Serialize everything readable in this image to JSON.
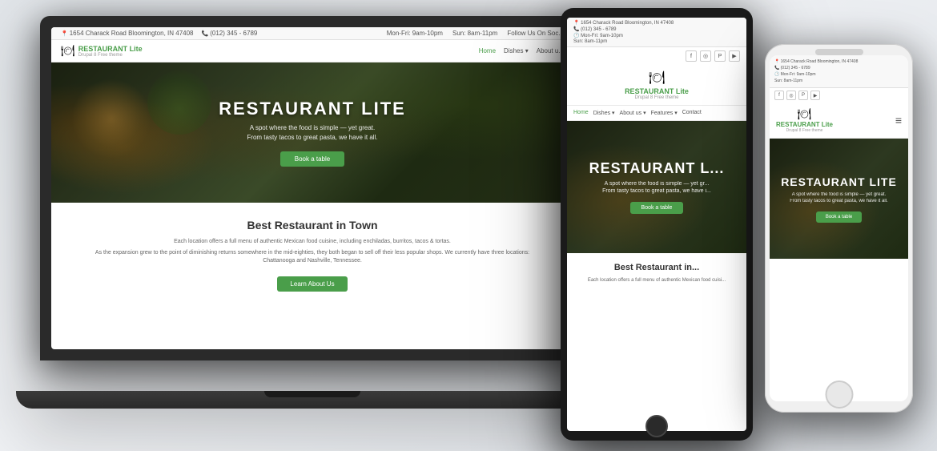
{
  "brand": {
    "name_prefix": "RESTAURANT",
    "name_suffix": "Lite",
    "drupal_label": "Drupal 8 Free theme",
    "icon": "🍽"
  },
  "topbar": {
    "address": "1654 Charack Road Bloomington, IN 47408",
    "phone": "(012) 345 - 6789",
    "hours_weekday": "Mon-Fri: 9am-10pm",
    "hours_weekend": "Sun: 8am-11pm",
    "follow_text": "Follow Us On Soc..."
  },
  "nav": {
    "items": [
      "Home",
      "Dishes ▾",
      "About us ▾",
      "Features ▾",
      "Contact"
    ],
    "active": "Home"
  },
  "hero": {
    "title": "RESTAURANT LITE",
    "subtitle1": "A spot where the food is simple — yet great.",
    "subtitle2": "From tasty tacos to great pasta, we have it all.",
    "cta": "Book a table"
  },
  "main": {
    "title": "Best Restaurant in Town",
    "text1": "Each location offers a full menu of authentic Mexican food cuisine, including enchiladas, burritos, tacos & tortas.",
    "text2": "As the expansion grew to the point of diminishing returns somewhere in the mid-eighties, they both began to sell off their less popular shops. We currently have three locations: Chattanooga and Nashville, Tennessee.",
    "cta": "Learn About Us"
  },
  "tablet_hero": {
    "title": "RESTAURANT L...",
    "subtitle1": "A spot where the food is simple — yet gr...",
    "subtitle2": "From tasty tacos to great pasta, we have i...",
    "cta": "Book a table"
  },
  "tablet_main": {
    "title": "Best Restaurant in...",
    "text1": "Each location offers a full menu of authentic Mexican food cuisi..."
  },
  "phone_hero": {
    "title": "RESTAURANT LITE",
    "subtitle1": "A spot where the food is simple — yet great.",
    "subtitle2": "From tasty tacos to great pasta, we have it all.",
    "cta": "Book a table"
  },
  "colors": {
    "green": "#4a9e4a",
    "dark": "#1a1a1a",
    "light_bg": "#f8f8f8"
  }
}
